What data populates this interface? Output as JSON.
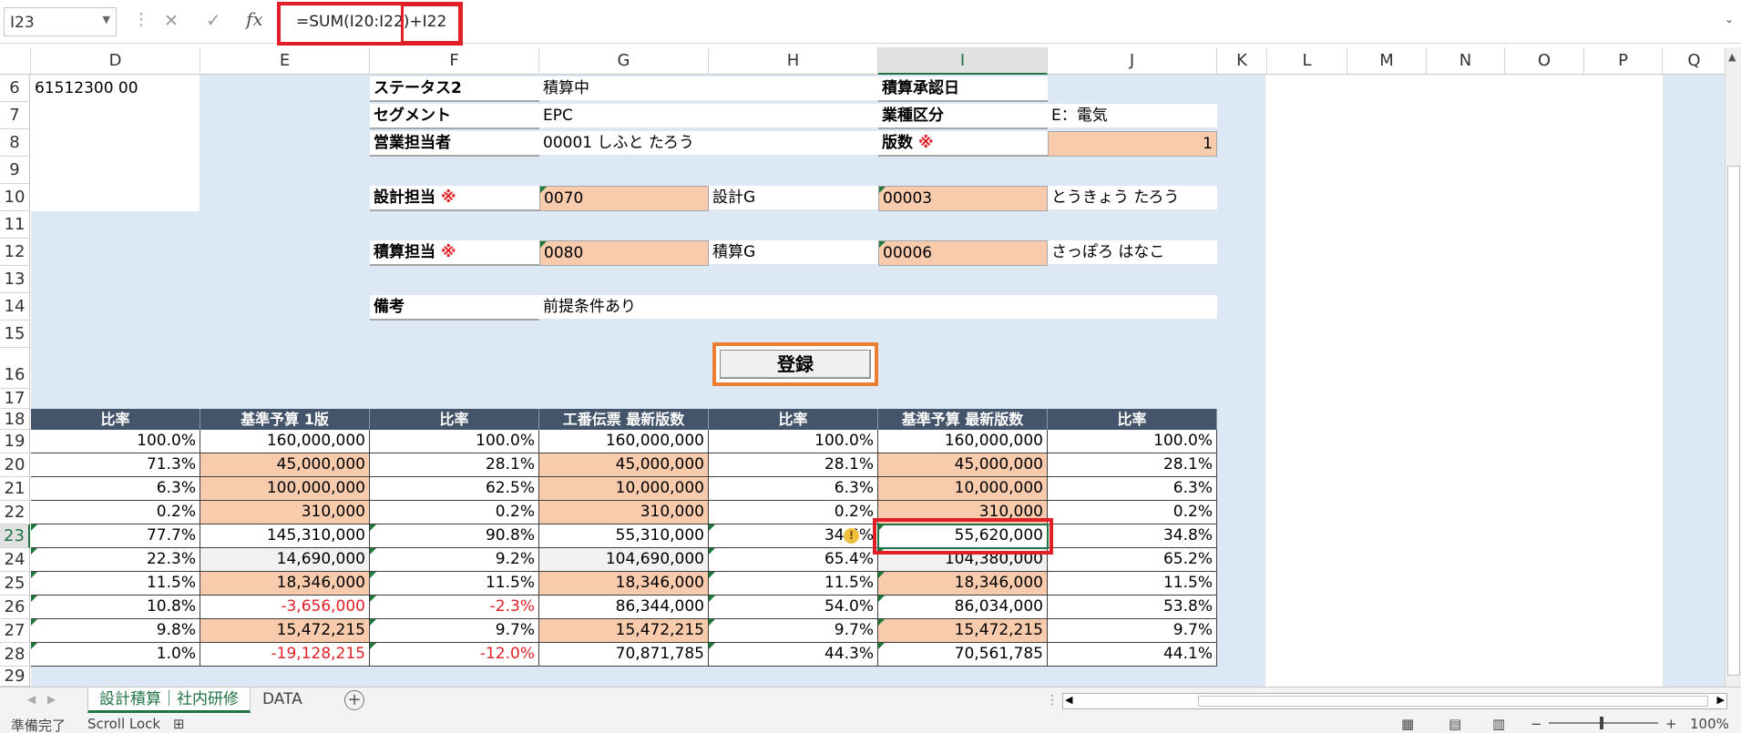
{
  "formula_bar": {
    "name_box": "I23",
    "formula": "=SUM(I20:I22)+I22",
    "fx": "fx"
  },
  "columns": [
    "D",
    "E",
    "F",
    "G",
    "H",
    "I",
    "J",
    "K",
    "L",
    "M",
    "N",
    "O",
    "P",
    "Q"
  ],
  "rows": [
    "6",
    "7",
    "8",
    "9",
    "10",
    "11",
    "12",
    "13",
    "14",
    "15",
    "16",
    "17",
    "18",
    "19",
    "20",
    "21",
    "22",
    "23",
    "24",
    "25",
    "26",
    "27",
    "28",
    "29"
  ],
  "selected_cell": {
    "col": "I",
    "row": "23"
  },
  "header_form": {
    "d6": "61512300 00",
    "status2_label": "ステータス2",
    "status2_value": "積算中",
    "approval_date_label": "積算承認日",
    "segment_label": "セグメント",
    "segment_value": "EPC",
    "industry_label": "業種区分",
    "industry_value": "E：電気",
    "sales_label": "営業担当者",
    "sales_value": "00001 しふと たろう",
    "edition_label": "版数",
    "edition_value": "1",
    "design_label": "設計担当",
    "design_code": "0070",
    "design_group": "設計G",
    "design_person_code": "00003",
    "design_person_name": "とうきょう たろう",
    "estimate_label": "積算担当",
    "estimate_code": "0080",
    "estimate_group": "積算G",
    "estimate_person_code": "00006",
    "estimate_person_name": "さっぽろ はなこ",
    "remarks_label": "備考",
    "remarks_value": "前提条件あり",
    "required_mark": "※",
    "register_button": "登録"
  },
  "table": {
    "headers": [
      "比率",
      "基準予算 1版",
      "比率",
      "工番伝票 最新版数",
      "比率",
      "基準予算 最新版数",
      "比率"
    ],
    "rows": [
      [
        "100.0%",
        "160,000,000",
        "100.0%",
        "160,000,000",
        "100.0%",
        "160,000,000",
        "100.0%"
      ],
      [
        "71.3%",
        "45,000,000",
        "28.1%",
        "45,000,000",
        "28.1%",
        "45,000,000",
        "28.1%"
      ],
      [
        "6.3%",
        "100,000,000",
        "62.5%",
        "10,000,000",
        "6.3%",
        "10,000,000",
        "6.3%"
      ],
      [
        "0.2%",
        "310,000",
        "0.2%",
        "310,000",
        "0.2%",
        "310,000",
        "0.2%"
      ],
      [
        "77.7%",
        "145,310,000",
        "90.8%",
        "55,310,000",
        "34.6%",
        "55,620,000",
        "34.8%"
      ],
      [
        "22.3%",
        "14,690,000",
        "9.2%",
        "104,690,000",
        "65.4%",
        "104,380,000",
        "65.2%"
      ],
      [
        "11.5%",
        "18,346,000",
        "11.5%",
        "18,346,000",
        "11.5%",
        "18,346,000",
        "11.5%"
      ],
      [
        "10.8%",
        "-3,656,000",
        "-2.3%",
        "86,344,000",
        "54.0%",
        "86,034,000",
        "53.8%"
      ],
      [
        "9.8%",
        "15,472,215",
        "9.7%",
        "15,472,215",
        "9.7%",
        "15,472,215",
        "9.7%"
      ],
      [
        "1.0%",
        "-19,128,215",
        "-12.0%",
        "70,871,785",
        "44.3%",
        "70,561,785",
        "44.1%"
      ]
    ]
  },
  "sheet_tabs": [
    "設計積算｜社内研修",
    "DATA"
  ],
  "active_tab": "設計積算｜社内研修",
  "status_bar": {
    "ready": "準備完了",
    "scroll_lock": "Scroll Lock",
    "zoom": "100%"
  }
}
